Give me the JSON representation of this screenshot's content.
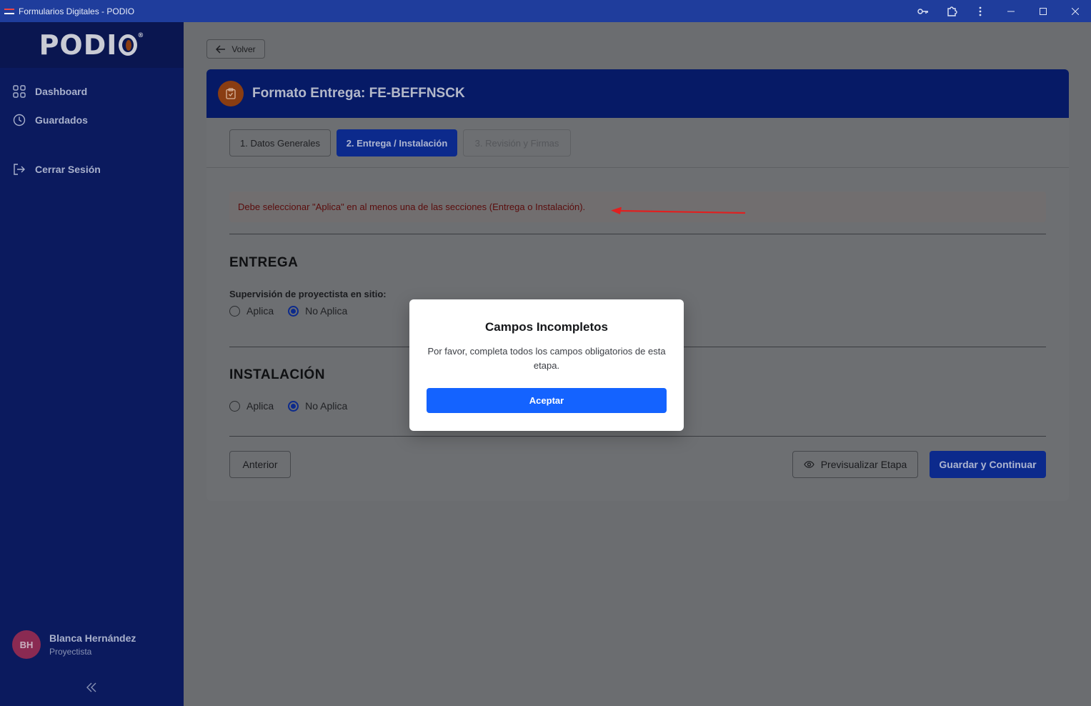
{
  "window": {
    "title": "Formularios Digitales - PODIO",
    "controls": [
      "minimize",
      "maximize",
      "close"
    ]
  },
  "sidebar": {
    "logo": "PODIO",
    "items": [
      {
        "label": "Dashboard",
        "icon": "grid-icon"
      },
      {
        "label": "Guardados",
        "icon": "clock-icon"
      },
      {
        "label": "Cerrar Sesión",
        "icon": "logout-icon"
      }
    ],
    "user": {
      "initials": "BH",
      "name": "Blanca Hernández",
      "role": "Proyectista"
    }
  },
  "main": {
    "back_label": "Volver",
    "header_title": "Formato Entrega: FE-BEFFNSCK",
    "tabs": [
      {
        "label": "1. Datos Generales",
        "state": "inactive"
      },
      {
        "label": "2. Entrega / Instalación",
        "state": "active"
      },
      {
        "label": "3. Revisión y Firmas",
        "state": "disabled"
      }
    ],
    "error_message": "Debe seleccionar \"Aplica\" en al menos una de las secciones (Entrega o Instalación).",
    "sections": [
      {
        "title": "ENTREGA",
        "field_label": "Supervisión de proyectista en sitio:",
        "options": [
          "Aplica",
          "No Aplica"
        ],
        "selected": "No Aplica"
      },
      {
        "title": "INSTALACIÓN",
        "options": [
          "Aplica",
          "No Aplica"
        ],
        "selected": "No Aplica"
      }
    ],
    "buttons": {
      "previous": "Anterior",
      "preview": "Previsualizar Etapa",
      "save": "Guardar y Continuar"
    }
  },
  "modal": {
    "title": "Campos Incompletos",
    "message": "Por favor, completa todos los campos obligatorios de esta etapa.",
    "accept": "Aceptar"
  },
  "colors": {
    "titlebar": "#1f3d9c",
    "sidebar": "#0b1a5e",
    "primary": "#1463ff",
    "annotation_arrow": "#e02020"
  }
}
